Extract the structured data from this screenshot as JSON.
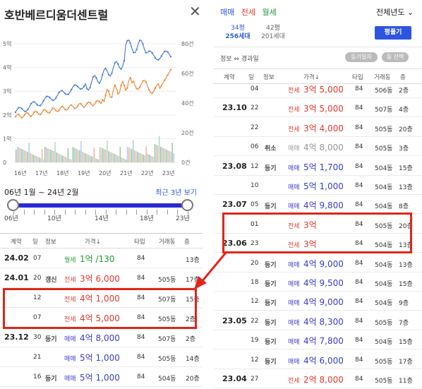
{
  "left": {
    "title": "호반베르디움더센트럴",
    "close_icon": "close-icon",
    "chart": {
      "left_ticks": [
        "5억",
        "4억",
        "3억",
        "2억",
        "1억",
        "0"
      ],
      "right_ticks": [
        "80건",
        "60건",
        "40건",
        "20건",
        "0건"
      ],
      "x_ticks": [
        "16년",
        "17년",
        "18년",
        "19년",
        "20년",
        "21년",
        "22년",
        "23년"
      ]
    },
    "range_text": "06년 1월 ~ 24년 2월",
    "range_link": "최근 3년 보기",
    "slider_labels": [
      "06년",
      "10년",
      "14년",
      "18년",
      "23년"
    ],
    "headers": [
      "계약",
      "일",
      "정보",
      "가격↓",
      "타입",
      "거래동",
      "층"
    ],
    "rows": [
      {
        "ym": "24.02",
        "day": "07",
        "info": "",
        "ptype": "월세",
        "price": "1억 /130",
        "ptype_color": "green",
        "type": "84",
        "dong": "",
        "floor": "13층"
      },
      {
        "ym": "24.01",
        "day": "20",
        "info": "갱신",
        "ptype": "전세",
        "price": "3억 6,000",
        "ptype_color": "red",
        "type": "84",
        "dong": "505동",
        "floor": "17층"
      },
      {
        "ym": "",
        "day": "12",
        "info": "",
        "ptype": "전세",
        "price": "4억 1,000",
        "ptype_color": "red",
        "type": "84",
        "dong": "507동",
        "floor": "15층"
      },
      {
        "ym": "",
        "day": "07",
        "info": "",
        "ptype": "전세",
        "price": "4억 5,000",
        "ptype_color": "red",
        "type": "84",
        "dong": "505동",
        "floor": "2층"
      },
      {
        "ym": "23.12",
        "day": "30",
        "info": "등기",
        "ptype": "매매",
        "price": "4억 8,000",
        "ptype_color": "blue",
        "type": "84",
        "dong": "507동",
        "floor": "2층"
      },
      {
        "ym": "",
        "day": "21",
        "info": "",
        "ptype": "매매",
        "price": "5억 1,000",
        "ptype_color": "blue",
        "type": "84",
        "dong": "505동",
        "floor": "14층"
      },
      {
        "ym": "",
        "day": "16",
        "info": "등기",
        "ptype": "매매",
        "price": "5억 1,000",
        "ptype_color": "blue",
        "type": "84",
        "dong": "504동",
        "floor": "20층"
      }
    ]
  },
  "right": {
    "tabs": [
      {
        "label": "매매",
        "color": "#2d55e0"
      },
      {
        "label": "전세",
        "color": "#e5372c"
      },
      {
        "label": "월세",
        "color": "#1d9a32"
      }
    ],
    "year_select": "전체년도 ⌄",
    "area_a": {
      "line1": "34평",
      "line2": "256세대"
    },
    "area_b": {
      "line1": "42평",
      "line2": "201세대"
    },
    "pyeong_button": "평풀기",
    "toggle_label": "정보 ↔ 경과일",
    "pill_1": "등기일자",
    "pill_2": "동 선택",
    "headers": [
      "계약",
      "일",
      "정보",
      "가격↓",
      "타입",
      "거래동",
      "층"
    ],
    "rows": [
      {
        "ym": "",
        "day": "04",
        "info": "",
        "ptype": "전세",
        "price": "3억 5,000",
        "pc": "red",
        "type": "84",
        "dong": "506동",
        "floor": "2층"
      },
      {
        "ym": "23.10",
        "day": "22",
        "info": "",
        "ptype": "전세",
        "price": "3억 5,000",
        "pc": "red",
        "type": "84",
        "dong": "507동",
        "floor": "4층"
      },
      {
        "ym": "",
        "day": "22",
        "info": "",
        "ptype": "전세",
        "price": "3억 4,000",
        "pc": "red",
        "type": "84",
        "dong": "505동",
        "floor": "20층"
      },
      {
        "ym": "",
        "day": "06",
        "info": "취소",
        "ptype": "매매",
        "price": "4억 8,000",
        "pc": "gray",
        "type": "84",
        "dong": "505동",
        "floor": "3층"
      },
      {
        "ym": "23.08",
        "day": "12",
        "info": "등기",
        "ptype": "매매",
        "price": "5억 1,700",
        "pc": "blue",
        "type": "84",
        "dong": "504동",
        "floor": "15층"
      },
      {
        "ym": "",
        "day": "10",
        "info": "",
        "ptype": "매매",
        "price": "5억 1,000",
        "pc": "blue",
        "type": "84",
        "dong": "504동",
        "floor": "13층"
      },
      {
        "ym": "23.07",
        "day": "05",
        "info": "등기",
        "ptype": "매매",
        "price": "4억 9,800",
        "pc": "blue",
        "type": "84",
        "dong": "504동",
        "floor": "8층"
      },
      {
        "ym": "",
        "day": "01",
        "info": "",
        "ptype": "전세",
        "price": "3억",
        "pc": "red",
        "type": "84",
        "dong": "505동",
        "floor": "20층"
      },
      {
        "ym": "23.06",
        "day": "23",
        "info": "",
        "ptype": "전세",
        "price": "3억",
        "pc": "red",
        "type": "84",
        "dong": "504동",
        "floor": "13층"
      },
      {
        "ym": "",
        "day": "20",
        "info": "등기",
        "ptype": "매매",
        "price": "4억 9,000",
        "pc": "blue",
        "type": "84",
        "dong": "504동",
        "floor": "13층"
      },
      {
        "ym": "",
        "day": "18",
        "info": "등기",
        "ptype": "매매",
        "price": "4억 9,500",
        "pc": "blue",
        "type": "84",
        "dong": "504동",
        "floor": "15층"
      },
      {
        "ym": "",
        "day": "12",
        "info": "등기",
        "ptype": "매매",
        "price": "4억 9,000",
        "pc": "blue",
        "type": "84",
        "dong": "504동",
        "floor": "9층"
      },
      {
        "ym": "23.05",
        "day": "22",
        "info": "등기",
        "ptype": "매매",
        "price": "4억 8,300",
        "pc": "blue",
        "type": "84",
        "dong": "505동",
        "floor": "7층"
      },
      {
        "ym": "",
        "day": "19",
        "info": "등기",
        "ptype": "매매",
        "price": "4억 7,800",
        "pc": "blue",
        "type": "84",
        "dong": "504동",
        "floor": "15층"
      },
      {
        "ym": "",
        "day": "12",
        "info": "등기",
        "ptype": "매매",
        "price": "4억 6,000",
        "pc": "blue",
        "type": "84",
        "dong": "505동",
        "floor": "17층"
      },
      {
        "ym": "23.04",
        "day": "27",
        "info": "",
        "ptype": "전세",
        "price": "2억 8,000",
        "pc": "red",
        "type": "84",
        "dong": "505동",
        "floor": "11층"
      }
    ]
  }
}
